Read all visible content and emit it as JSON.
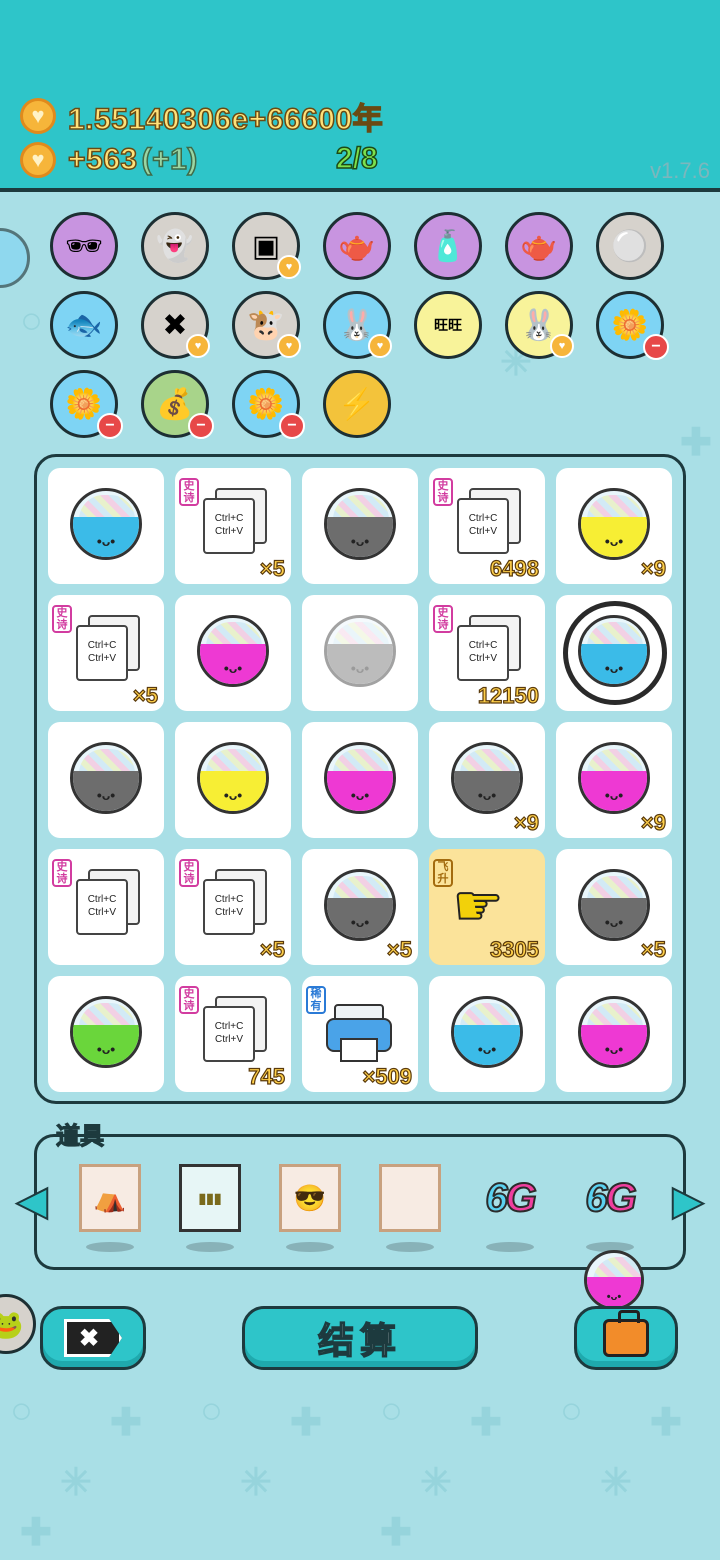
{
  "hud": {
    "coins_text": "1.55140306e+66600年",
    "rate_text": "+563",
    "rate_bonus": "(+1)",
    "progress": "2/8",
    "version": "v1.7.6"
  },
  "icons": {
    "currency": "heart-coin-icon"
  },
  "collection_rows": [
    [
      "pet-with-glasses",
      "ghost",
      "tofu-cubes",
      "gravy-boat",
      "spray-bottle",
      "gravy-boat",
      "egg-tray"
    ],
    [
      "fish-bowl",
      "tag",
      "cow-pair",
      "rabbit",
      "wang-tiles",
      "rabbit",
      "flower-pot"
    ],
    [
      "flower-pot",
      "money-bag",
      "flower-pot",
      "lightning"
    ]
  ],
  "grid": [
    {
      "type": "bowl",
      "color": "blue",
      "count": ""
    },
    {
      "type": "copy",
      "tag": "史诗",
      "card_line1": "Ctrl+C",
      "card_line2": "Ctrl+V",
      "count": "×5"
    },
    {
      "type": "bowl",
      "color": "gray",
      "count": ""
    },
    {
      "type": "copy",
      "tag": "史诗",
      "card_line1": "Ctrl+C",
      "card_line2": "Ctrl+V",
      "count": "6498"
    },
    {
      "type": "bowl",
      "color": "yellow",
      "count": "×9"
    },
    {
      "type": "copy",
      "tag": "史诗",
      "card_line1": "Ctrl+C",
      "card_line2": "Ctrl+V",
      "count": "×5"
    },
    {
      "type": "bowl",
      "color": "pink",
      "count": ""
    },
    {
      "type": "bowl",
      "color": "faded",
      "count": ""
    },
    {
      "type": "copy",
      "tag": "史诗",
      "card_line1": "Ctrl+C",
      "card_line2": "Ctrl+V",
      "count": "12150"
    },
    {
      "type": "bowl",
      "color": "blue",
      "ring": true,
      "count": ""
    },
    {
      "type": "bowl",
      "color": "gray",
      "count": ""
    },
    {
      "type": "bowl",
      "color": "yellow",
      "count": ""
    },
    {
      "type": "bowl",
      "color": "pink",
      "count": ""
    },
    {
      "type": "bowl",
      "color": "gray",
      "count": "×9"
    },
    {
      "type": "bowl",
      "color": "pink",
      "count": "×9"
    },
    {
      "type": "copy",
      "tag": "史诗",
      "card_line1": "Ctrl+C",
      "card_line2": "Ctrl+V",
      "count": ""
    },
    {
      "type": "copy",
      "tag": "史诗",
      "card_line1": "Ctrl+C",
      "card_line2": "Ctrl+V",
      "count": "×5"
    },
    {
      "type": "bowl",
      "color": "gray",
      "count": "×5"
    },
    {
      "type": "hand",
      "tag": "飞升",
      "count": "3305"
    },
    {
      "type": "bowl",
      "color": "gray",
      "count": "×5"
    },
    {
      "type": "bowl",
      "color": "green",
      "count": ""
    },
    {
      "type": "copy",
      "tag": "史诗",
      "card_line1": "Ctrl+C",
      "card_line2": "Ctrl+V",
      "count": "745"
    },
    {
      "type": "printer",
      "tag": "稀有",
      "count": "×509"
    },
    {
      "type": "bowl",
      "color": "blue",
      "count": ""
    },
    {
      "type": "bowl",
      "color": "pink",
      "count": ""
    }
  ],
  "tools": {
    "label": "道具",
    "items": [
      {
        "name": "tent-frame",
        "text": ""
      },
      {
        "name": "legend-cards",
        "text": ""
      },
      {
        "name": "face-frame",
        "text": ""
      },
      {
        "name": "blank-frame",
        "text": ""
      },
      {
        "name": "6g-a",
        "text": "6G"
      },
      {
        "name": "6g-b",
        "text": "6G"
      }
    ]
  },
  "buttons": {
    "settle": "结算",
    "close_glyph": "✖"
  }
}
